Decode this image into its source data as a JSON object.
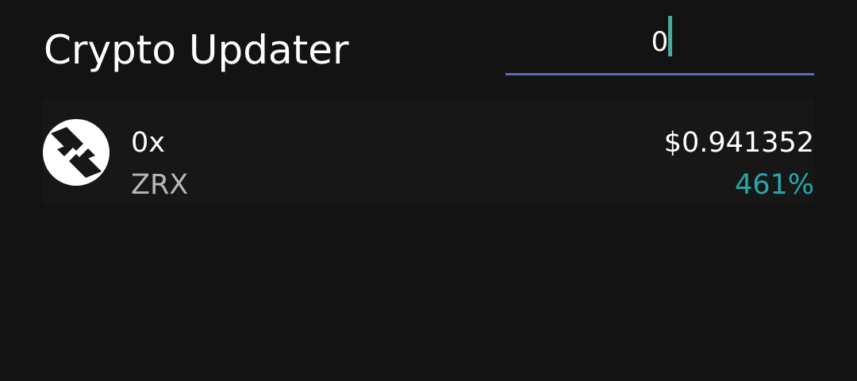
{
  "app": {
    "title": "Crypto Updater"
  },
  "search": {
    "value": "0",
    "placeholder": ""
  },
  "coins": [
    {
      "name": "0x",
      "symbol": "ZRX",
      "price": "$0.941352",
      "change": "461%",
      "icon": "0x-logo-icon"
    }
  ],
  "colors": {
    "background": "#131313",
    "card": "#171717",
    "underline": "#5c6bc0",
    "caret": "#4aa99b",
    "change_positive": "#26a8a8",
    "symbol_text": "#b7b7b7"
  }
}
